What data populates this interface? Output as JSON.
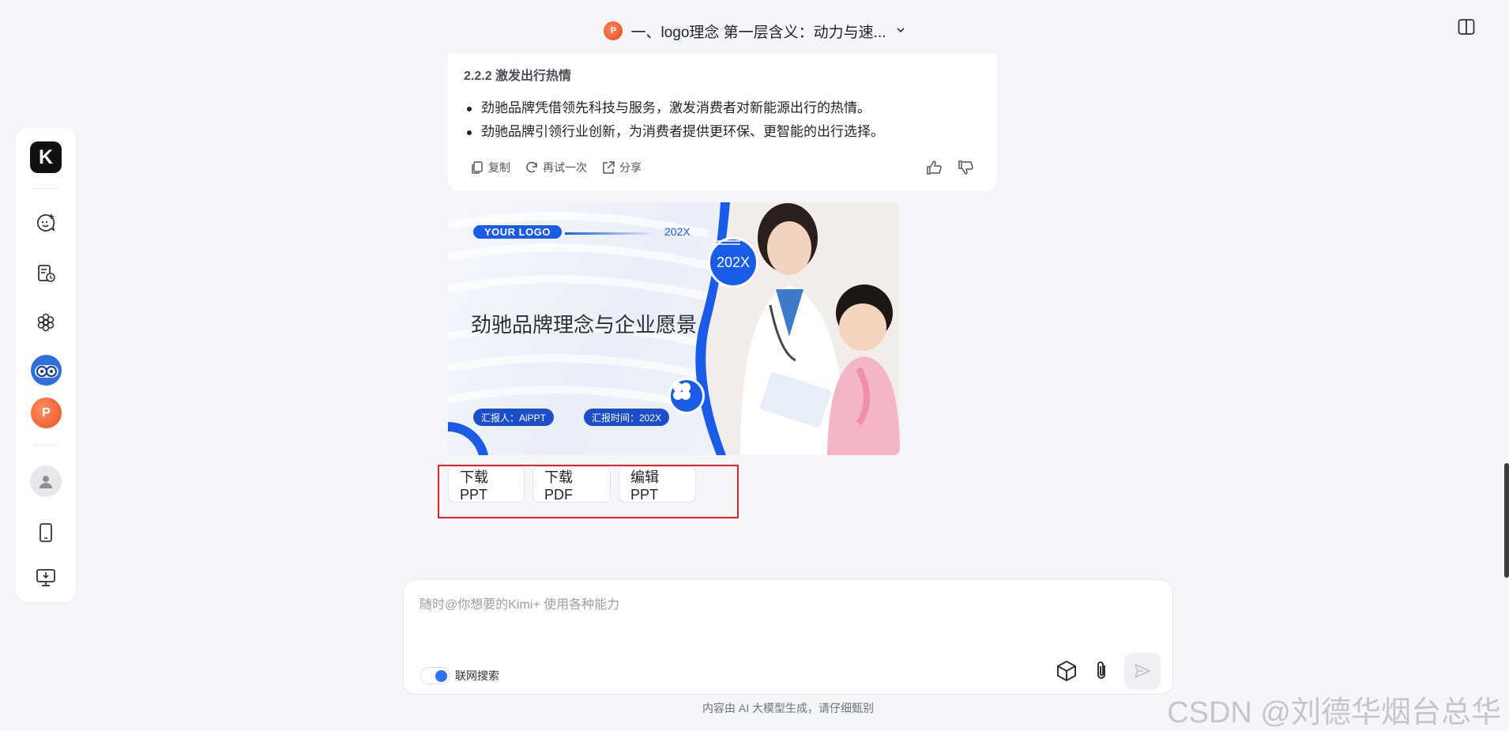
{
  "header": {
    "file_icon_letter": "P",
    "title": "一、logo理念 第一层含义：动力与速...",
    "dropdown_icon": "chevron-down-icon",
    "split_view_icon": "split-view-icon"
  },
  "sidebar": {
    "logo_letter": "K",
    "items": [
      {
        "name": "new-chat-icon"
      },
      {
        "name": "history-icon"
      },
      {
        "name": "explore-icon"
      },
      {
        "name": "robot-avatar"
      },
      {
        "name": "ppt-avatar",
        "letter": "P"
      },
      {
        "name": "user-avatar"
      },
      {
        "name": "mobile-icon"
      },
      {
        "name": "desktop-download-icon"
      }
    ]
  },
  "message": {
    "heading": "2.2.2 激发出行热情",
    "bullets": [
      "劲驰品牌凭借领先科技与服务，激发消费者对新能源出行的热情。",
      "劲驰品牌引领行业创新，为消费者提供更环保、更智能的出行选择。"
    ],
    "actions": {
      "copy": "复制",
      "retry": "再试一次",
      "share": "分享"
    }
  },
  "slide": {
    "logo": "YOUR LOGO",
    "year_top": "202X",
    "badge_year": "202X",
    "title": "劲驰品牌理念与企业愿景",
    "reporter": "汇报人：AiPPT",
    "report_time": "汇报时间：202X"
  },
  "buttons": {
    "download_ppt": "下载PPT",
    "download_pdf": "下载PDF",
    "edit_ppt": "编辑PPT"
  },
  "composer": {
    "placeholder": "随时@你想要的Kimi+ 使用各种能力",
    "search_toggle_label": "联网搜索",
    "search_enabled": true
  },
  "footer": {
    "disclaimer": "内容由 AI 大模型生成，请仔细甄别",
    "watermark": "CSDN @刘德华烟台总华"
  },
  "colors": {
    "accent": "#1a5be8",
    "highlight_border": "#e0242a",
    "background": "#f5f6f9"
  }
}
